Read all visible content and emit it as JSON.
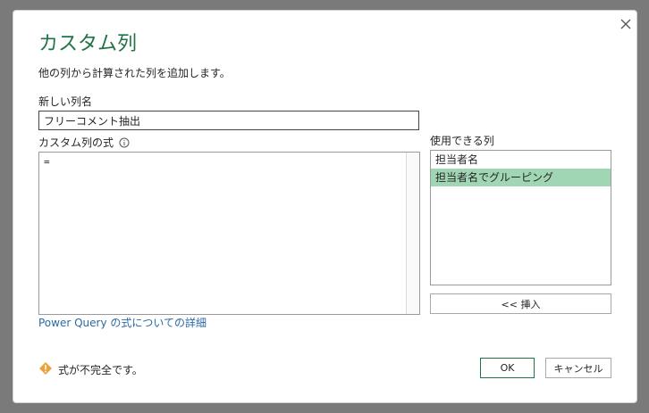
{
  "dialog": {
    "title": "カスタム列",
    "subtitle": "他の列から計算された列を追加します。",
    "close_icon": "close-icon"
  },
  "new_column": {
    "label": "新しい列名",
    "value": "フリーコメント抽出"
  },
  "formula": {
    "label": "カスタム列の式",
    "info_icon": "info-icon",
    "value": "="
  },
  "available_columns": {
    "label": "使用できる列",
    "items": [
      "担当者名",
      "担当者名でグルーピング"
    ],
    "selected_index": 1
  },
  "buttons": {
    "insert": "<< 挿入",
    "ok": "OK",
    "cancel": "キャンセル"
  },
  "link": "Power Query の式についての詳細",
  "status": {
    "icon": "warning-icon",
    "text": "式が不完全です。"
  },
  "colors": {
    "accent": "#217346",
    "selected_row": "#a0d6b4",
    "link": "#2b6aa5",
    "warning": "#e8a33b"
  }
}
